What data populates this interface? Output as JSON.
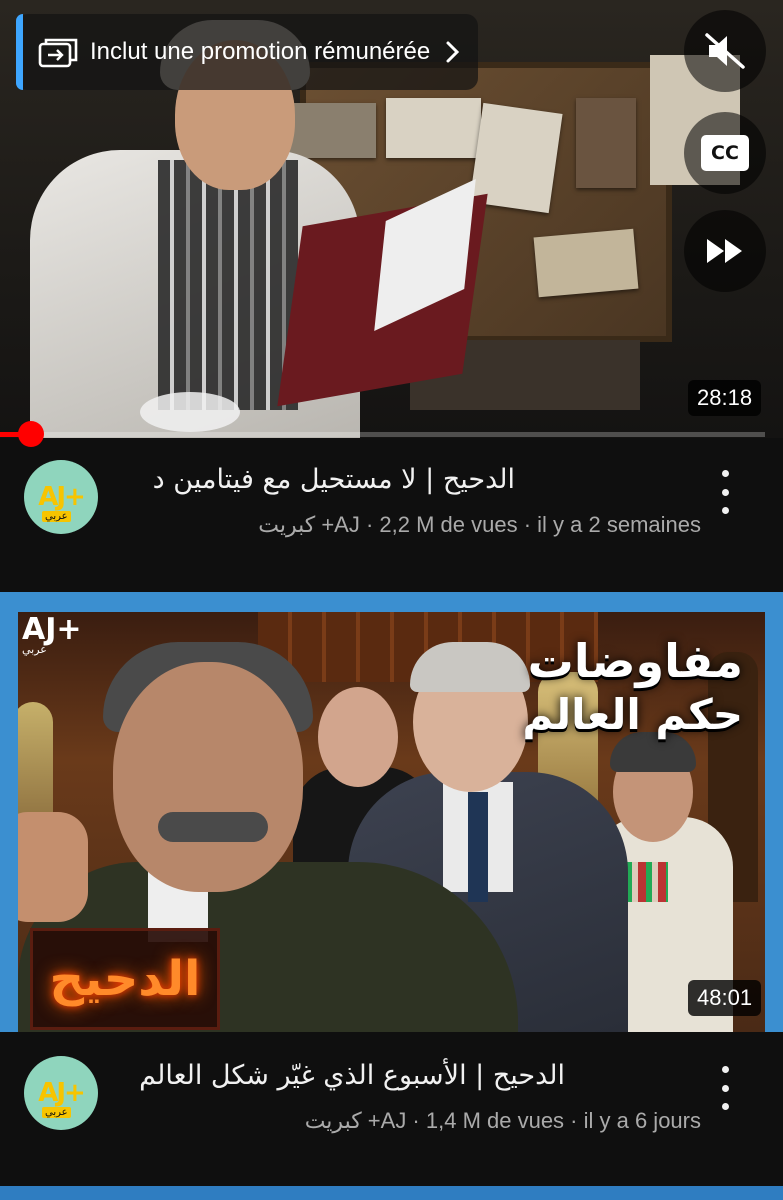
{
  "app": "YouTube",
  "icons": {
    "promo": "promotion-icon",
    "chevron": "chevron-right-icon",
    "mute": "mute-icon",
    "captions": "captions-icon",
    "fast_forward": "fast-forward-icon",
    "more": "more-vert-icon"
  },
  "colors": {
    "background": "#0f0f0f",
    "progress": "#ff0000",
    "promo_accent": "#3ea6ff",
    "avatar_bg": "#8fd5bd",
    "brand_yellow": "#f7c400"
  },
  "player": {
    "promo_label": "Inclut une promotion rémunérée",
    "captions_label": "CC",
    "duration": "28:18",
    "progress_fraction": 0.03
  },
  "videos": [
    {
      "title": "الدحيح | لا مستحيل مع فيتامين د",
      "subtitle": "كبريت +AJ · 2,2 M de vues · il y a 2 semaines",
      "duration": "28:18",
      "channel_logo": "AJ+",
      "channel_logo_sub": "عربي"
    },
    {
      "title": "الدحيح | الأسبوع الذي غيّر شكل العالم",
      "subtitle": "كبريت +AJ · 1,4 M de vues · il y a 6 jours",
      "duration": "48:01",
      "channel_logo": "AJ+",
      "channel_logo_sub": "عربي",
      "thumb_title_line1": "مفاوضات",
      "thumb_title_line2": "حكم العالم",
      "thumb_neon": "الدحيح",
      "thumb_logo": "AJ+",
      "thumb_logo_sub": "عربي"
    }
  ]
}
